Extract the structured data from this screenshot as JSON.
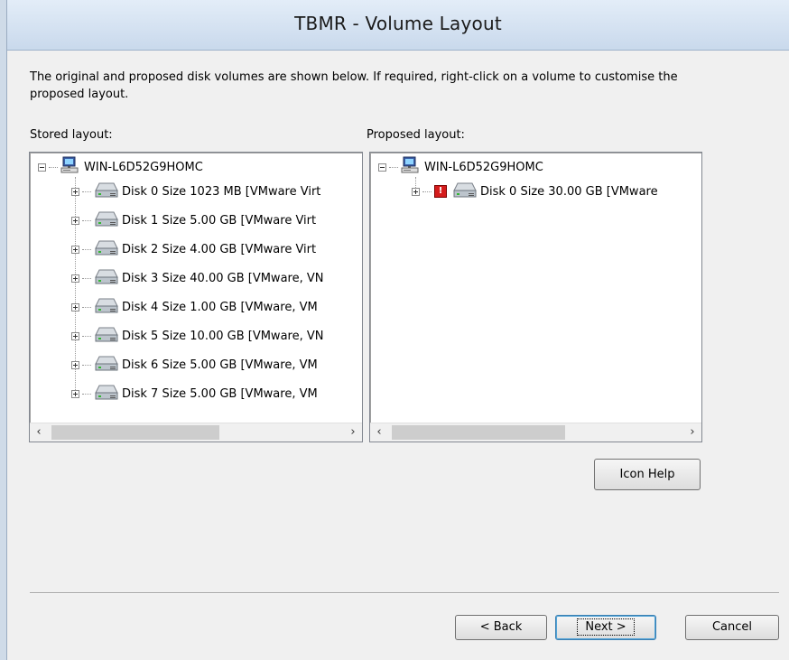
{
  "window": {
    "title": "TBMR - Volume Layout"
  },
  "intro": "The original and proposed disk volumes are shown below. If required, right-click on a volume to customise the proposed layout.",
  "stored": {
    "label": "Stored layout:",
    "root": "WIN-L6D52G9HOMC",
    "disks": [
      "Disk 0 Size 1023 MB [VMware Virt",
      "Disk 1 Size  5.00 GB [VMware Virt",
      "Disk 2 Size  4.00 GB [VMware Virt",
      "Disk 3 Size 40.00 GB [VMware, VN",
      "Disk 4 Size  1.00 GB [VMware, VM",
      "Disk 5 Size 10.00 GB [VMware, VN",
      "Disk 6 Size  5.00 GB [VMware, VM",
      "Disk 7 Size  5.00 GB [VMware, VM"
    ]
  },
  "proposed": {
    "label": "Proposed layout:",
    "root": "WIN-L6D52G9HOMC",
    "disks": [
      "Disk 0 Size 30.00 GB [VMware"
    ]
  },
  "buttons": {
    "icon_help": "Icon Help",
    "back": "< Back",
    "next": "Next >",
    "cancel": "Cancel"
  },
  "icons": {
    "computer": "computer-icon",
    "disk": "hard-disk-icon",
    "error": "error-icon",
    "scroll_left": "‹",
    "scroll_right": "›"
  },
  "colors": {
    "titlebar": "#c9d9ec",
    "error": "#d51c1c"
  }
}
